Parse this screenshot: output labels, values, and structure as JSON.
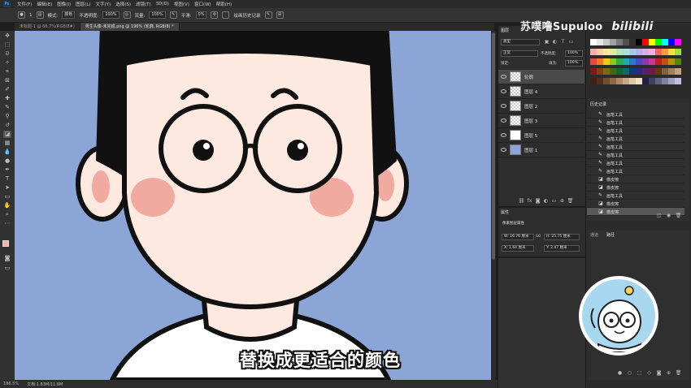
{
  "menu": [
    "文件(F)",
    "编辑(E)",
    "图像(I)",
    "图层(L)",
    "文字(Y)",
    "选择(S)",
    "滤镜(T)",
    "3D(D)",
    "视图(V)",
    "窗口(W)",
    "帮助(H)"
  ],
  "app_logo": "Ps",
  "options_bar": {
    "brush_size": "1",
    "mode_label": "模式:",
    "mode_value": "颜色",
    "opacity_label": "不透明度:",
    "opacity_value": "100%",
    "flow_label": "流量:",
    "flow_value": "100%",
    "smoothing_label": "平滑:",
    "smoothing_value": "0%",
    "history_label": "绘画历史记录"
  },
  "tabs": [
    {
      "label": "未标题-1 @ 66.7%(RGB/8#)"
    },
    {
      "label": "男生头像-未完成.png @ 196% (轮廓, RGB/8) *"
    }
  ],
  "status": {
    "zoom": "196.5%",
    "doc": "文档:1.83M/11.6M"
  },
  "brand": "苏噗噜Supuloo",
  "brand_logo": "bilibili",
  "subtitle": "替换成更适合的颜色",
  "layers_panel": {
    "tab_label": "图层",
    "kind_label": "类型",
    "blend_mode": "正常",
    "opacity_label": "不透明度:",
    "opacity_value": "100%",
    "lock_label": "锁定:",
    "fill_label": "填充:",
    "fill_value": "100%",
    "layers": [
      {
        "name": "轮廓",
        "selected": true
      },
      {
        "name": "图层 4",
        "selected": false
      },
      {
        "name": "图层 2",
        "selected": false
      },
      {
        "name": "图层 3",
        "selected": false
      },
      {
        "name": "图层 5",
        "selected": false
      },
      {
        "name": "图层 1",
        "selected": false
      }
    ]
  },
  "properties_panel": {
    "tab_label": "属性",
    "subtitle": "像素图层属性",
    "w": "W: 16.76 厘米",
    "h": "H: 25.75 厘米",
    "x": "X: 1.64 厘米",
    "y": "Y: 2.47 厘米",
    "link": "GO"
  },
  "history_panel": {
    "tab_label": "历史记录",
    "items": [
      {
        "icon": "brush",
        "label": "画笔工具",
        "selected": false
      },
      {
        "icon": "brush",
        "label": "画笔工具",
        "selected": false
      },
      {
        "icon": "brush",
        "label": "画笔工具",
        "selected": false
      },
      {
        "icon": "brush",
        "label": "画笔工具",
        "selected": false
      },
      {
        "icon": "brush",
        "label": "画笔工具",
        "selected": false
      },
      {
        "icon": "brush",
        "label": "画笔工具",
        "selected": false
      },
      {
        "icon": "brush",
        "label": "画笔工具",
        "selected": false
      },
      {
        "icon": "brush",
        "label": "画笔工具",
        "selected": false
      },
      {
        "icon": "eraser",
        "label": "橡皮擦",
        "selected": false
      },
      {
        "icon": "eraser",
        "label": "橡皮擦",
        "selected": false
      },
      {
        "icon": "brush",
        "label": "画笔工具",
        "selected": false
      },
      {
        "icon": "eraser",
        "label": "橡皮擦",
        "selected": false
      },
      {
        "icon": "eraser",
        "label": "橡皮擦",
        "selected": true
      }
    ]
  },
  "paths_panel": {
    "tabs": [
      "通道",
      "路径"
    ]
  },
  "colors": {
    "canvas_bg": "#8aa5d6",
    "skin": "#fde9df",
    "blush": "#f1aaa0",
    "hair": "#111111",
    "foreground": "#f4b6a4"
  }
}
